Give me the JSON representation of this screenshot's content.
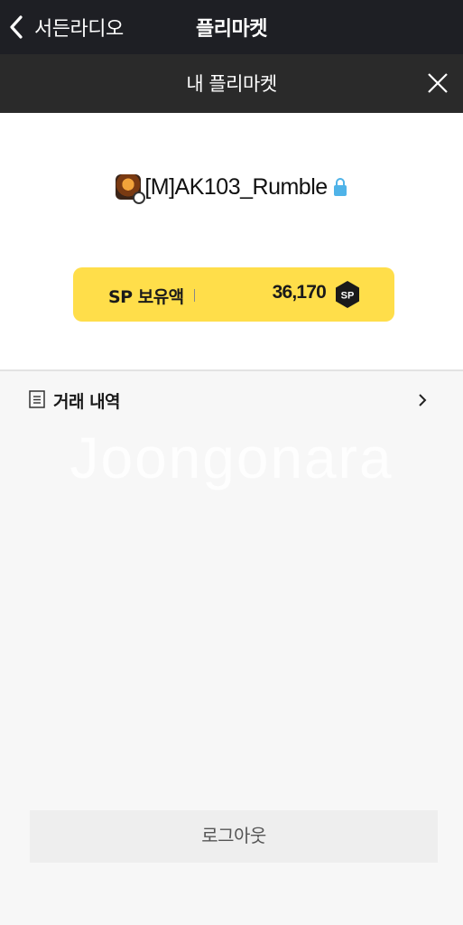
{
  "header": {
    "back_label": "서든라디오",
    "title": "플리마켓"
  },
  "subheader": {
    "title": "내 플리마켓"
  },
  "profile": {
    "username": "[M]AK103_Rumble"
  },
  "sp": {
    "label": "SP 보유액",
    "amount": "36,170",
    "badge": "SP"
  },
  "history": {
    "label": "거래 내역"
  },
  "watermark": "Joongonara",
  "logout_label": "로그아웃",
  "colors": {
    "topbar": "#1e1f24",
    "subbar": "#2a2a2a",
    "sp_card": "#ffde4a",
    "lock": "#4fb3e8"
  }
}
